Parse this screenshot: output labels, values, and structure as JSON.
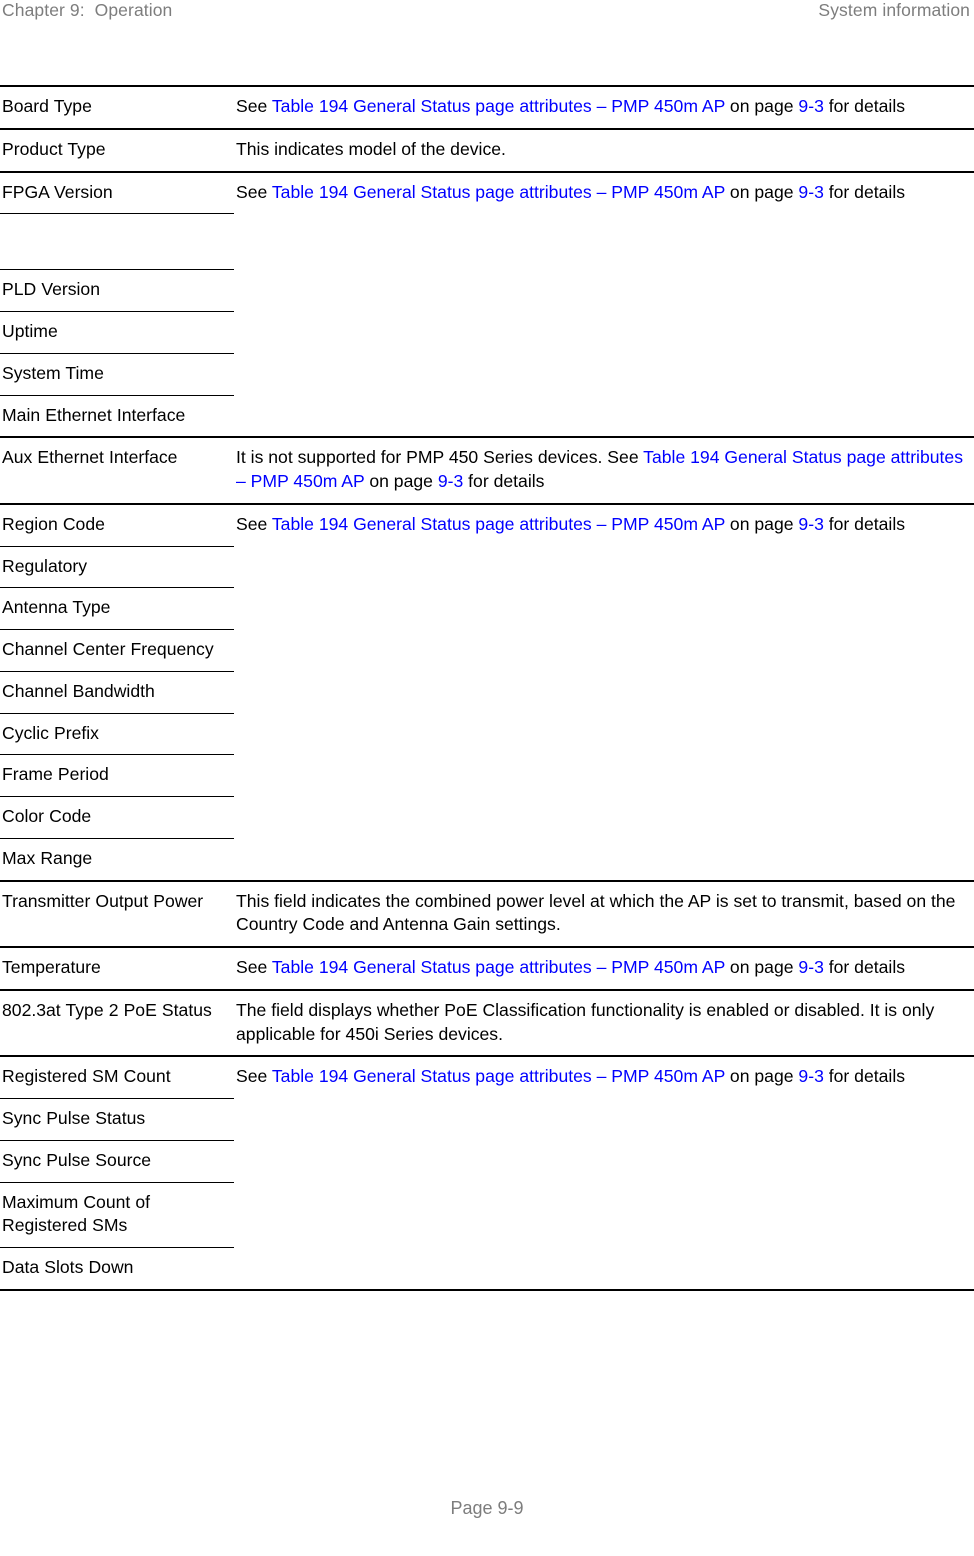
{
  "header": {
    "left": "Chapter 9:  Operation",
    "right": "System information"
  },
  "footer": {
    "page_label": "Page 9-9"
  },
  "colors": {
    "xref": "#0000ff",
    "header_text": "#7d7d7d",
    "body_text": "#000000",
    "rule": "#000000"
  },
  "xref": {
    "see": "See ",
    "link_main": "Table 194 General Status page attributes – PMP 450m AP",
    "on_page": " on page ",
    "page_num": "9-3",
    "for_details": " for details"
  },
  "table": {
    "rows": [
      {
        "id": "board-type",
        "label": "Board Type",
        "rule": "full",
        "desc_kind": "xref",
        "desc_rowspan": 1,
        "desc_prefix": ""
      },
      {
        "id": "product-type",
        "label": "Product Type",
        "rule": "full",
        "desc_kind": "plain",
        "desc_text": "This indicates model of the device."
      },
      {
        "id": "fpga-version",
        "label": "FPGA Version",
        "rule": "full",
        "desc_kind": "xref",
        "desc_prefix": ""
      },
      {
        "id": "blank-continuation",
        "label": "",
        "rule": "sub"
      },
      {
        "id": "pld-version",
        "label": "PLD Version",
        "rule": "sub"
      },
      {
        "id": "uptime",
        "label": "Uptime",
        "rule": "sub"
      },
      {
        "id": "system-time",
        "label": "System Time",
        "rule": "sub"
      },
      {
        "id": "main-ethernet-interface",
        "label": "Main Ethernet Interface",
        "rule": "sub"
      },
      {
        "id": "aux-ethernet-interface",
        "label": "Aux Ethernet Interface",
        "rule": "full",
        "desc_kind": "xref",
        "desc_prefix": "It is not supported for PMP 450 Series devices. "
      },
      {
        "id": "region-code",
        "label": "Region Code",
        "rule": "full",
        "desc_kind": "xref",
        "desc_prefix": ""
      },
      {
        "id": "regulatory",
        "label": "Regulatory",
        "rule": "sub"
      },
      {
        "id": "antenna-type",
        "label": "Antenna Type",
        "rule": "sub"
      },
      {
        "id": "channel-center-frequency",
        "label": "Channel Center Frequency",
        "rule": "sub"
      },
      {
        "id": "channel-bandwidth",
        "label": "Channel Bandwidth",
        "rule": "sub"
      },
      {
        "id": "cyclic-prefix",
        "label": "Cyclic Prefix",
        "rule": "sub"
      },
      {
        "id": "frame-period",
        "label": "Frame Period",
        "rule": "sub"
      },
      {
        "id": "color-code",
        "label": "Color Code",
        "rule": "sub"
      },
      {
        "id": "max-range",
        "label": "Max Range",
        "rule": "sub"
      },
      {
        "id": "transmitter-output-power",
        "label": "Transmitter Output Power",
        "rule": "full",
        "desc_kind": "plain",
        "desc_text": "This field indicates the combined power level at which the AP is set to transmit, based on the Country Code and Antenna Gain settings."
      },
      {
        "id": "temperature",
        "label": "Temperature",
        "rule": "full",
        "desc_kind": "xref",
        "desc_prefix": ""
      },
      {
        "id": "poe-status",
        "label": "802.3at Type 2 PoE Status",
        "rule": "full",
        "desc_kind": "plain",
        "desc_text": "The field displays whether PoE Classification functionality is enabled or disabled. It is only applicable for 450i Series devices."
      },
      {
        "id": "registered-sm-count",
        "label": "Registered SM Count",
        "rule": "full",
        "desc_kind": "xref",
        "desc_prefix": ""
      },
      {
        "id": "sync-pulse-status",
        "label": "Sync Pulse Status",
        "rule": "sub"
      },
      {
        "id": "sync-pulse-source",
        "label": "Sync Pulse Source",
        "rule": "sub"
      },
      {
        "id": "maximum-count-of-registered-sms",
        "label": "Maximum Count of Registered SMs",
        "rule": "sub"
      },
      {
        "id": "data-slots-down",
        "label": "Data Slots Down",
        "rule": "sub",
        "last": true
      }
    ]
  }
}
